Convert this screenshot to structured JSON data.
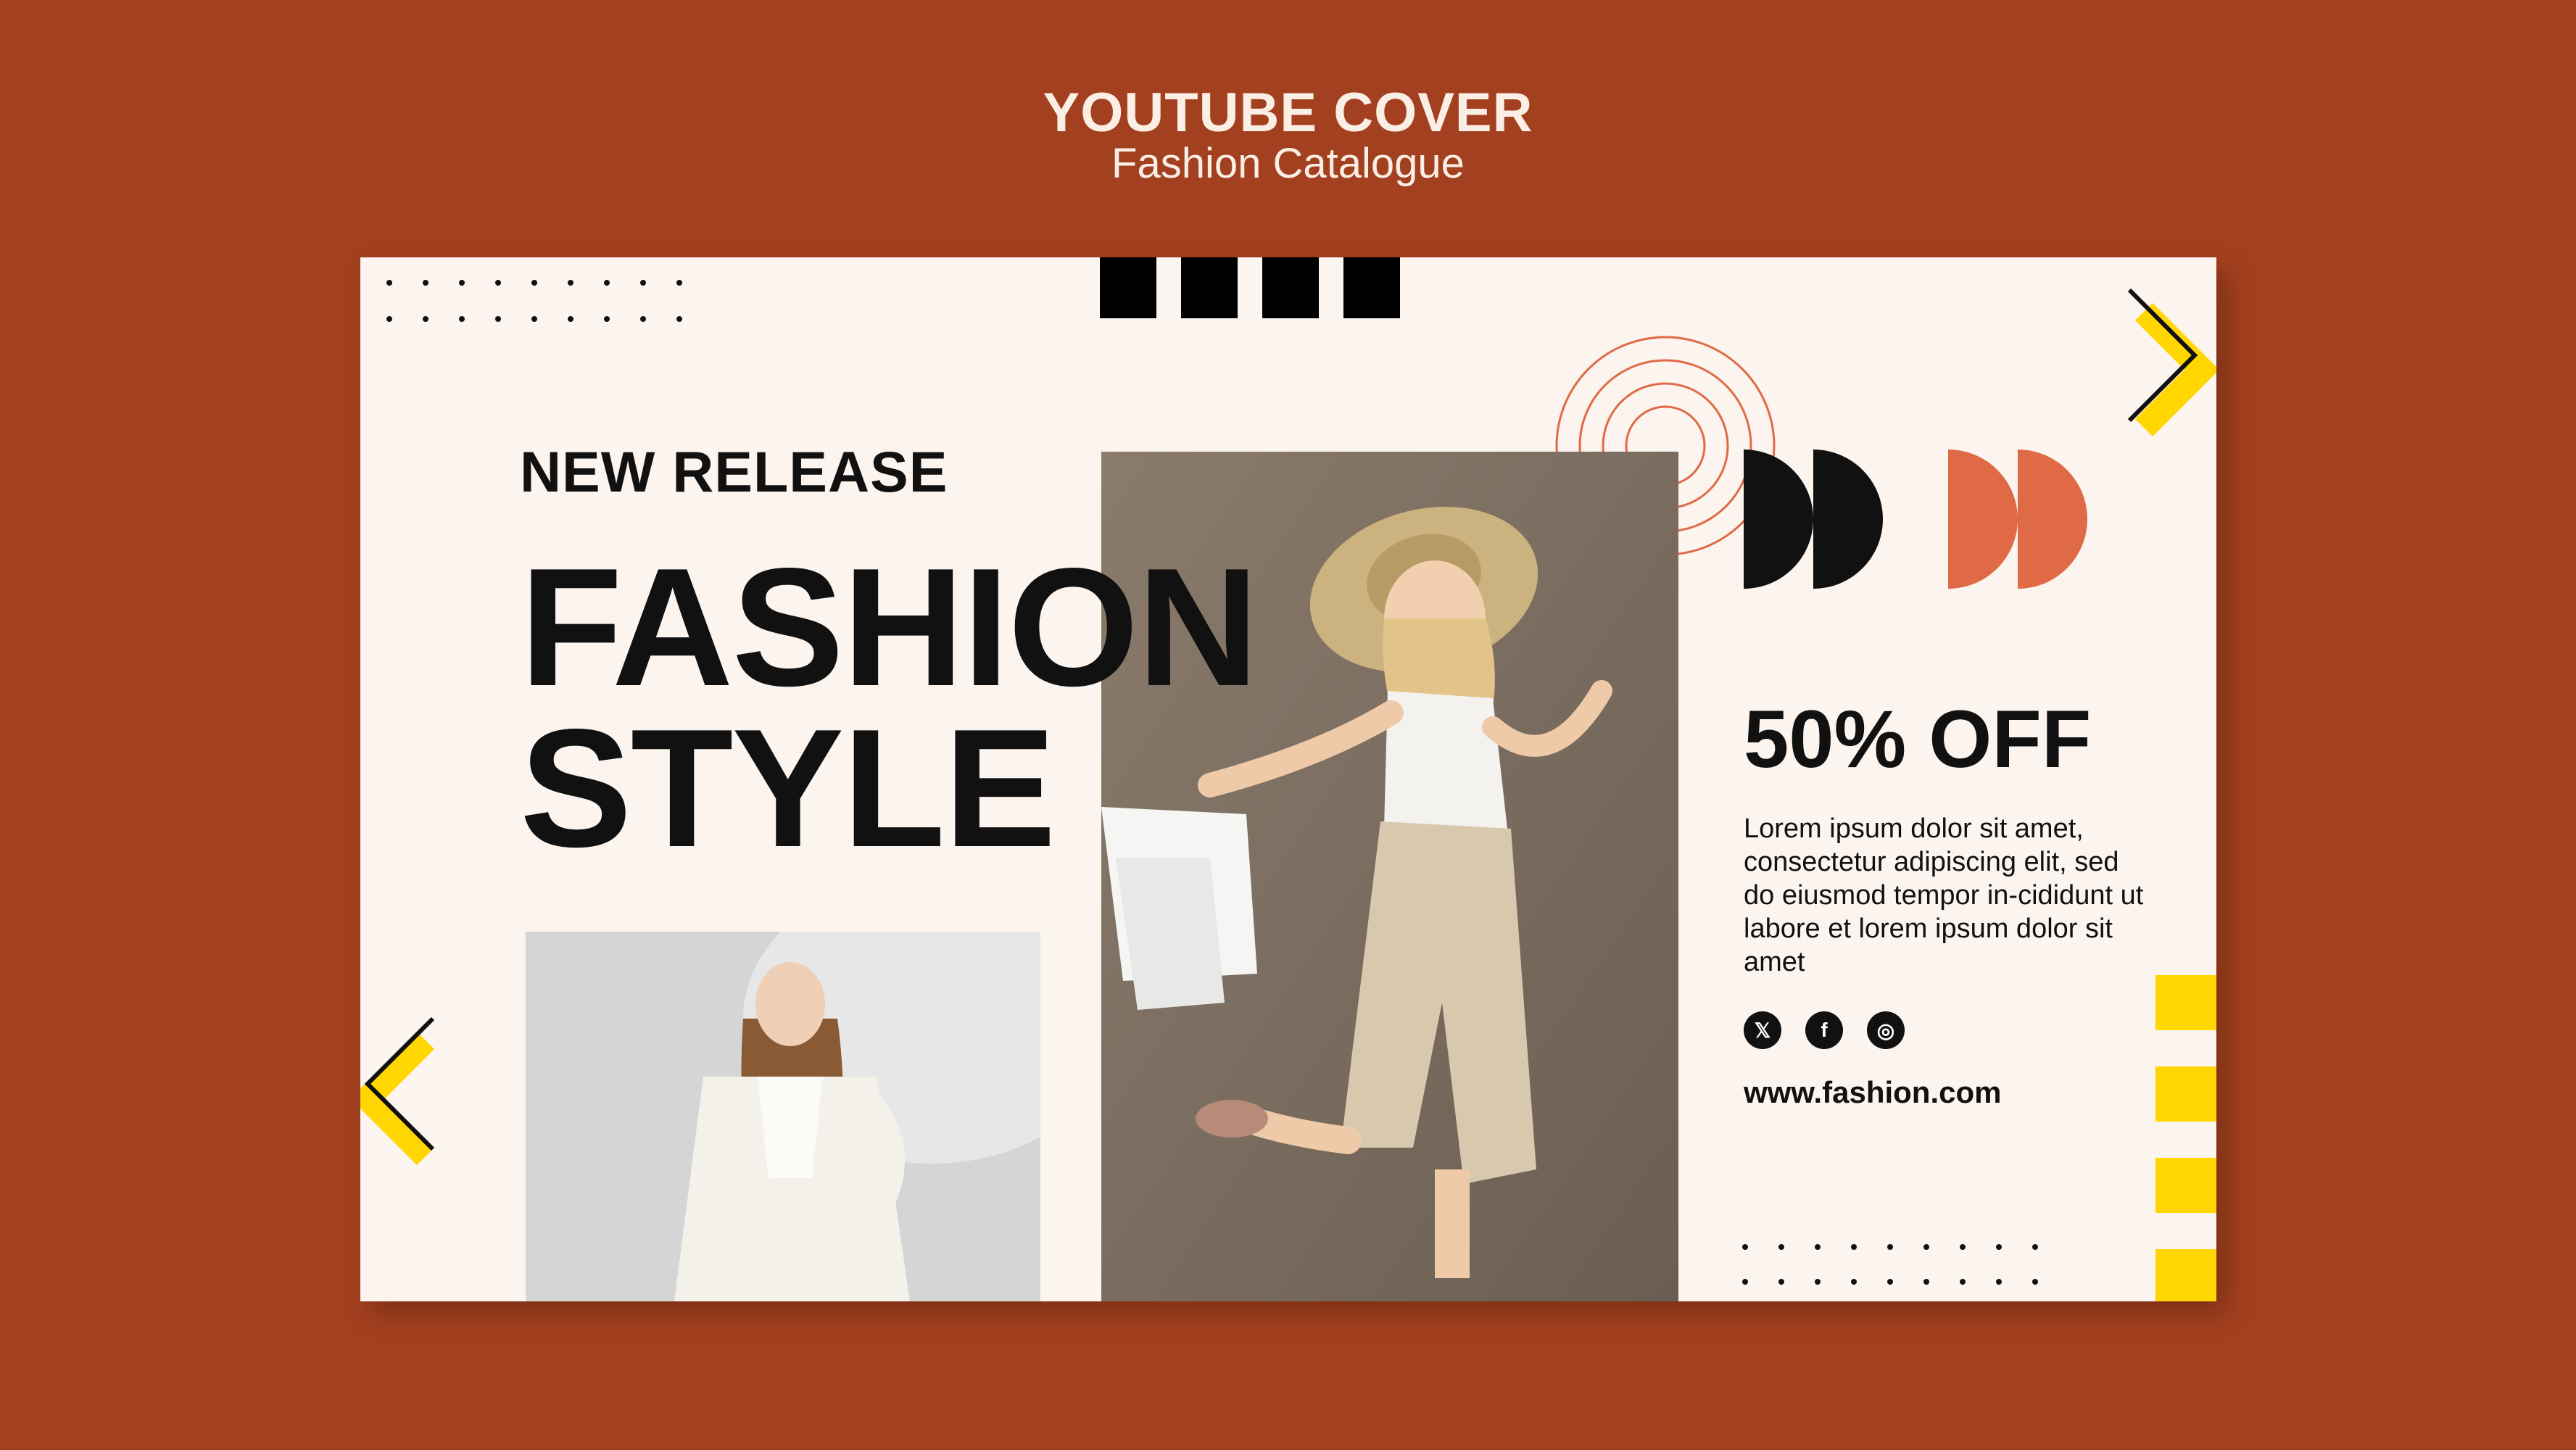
{
  "header": {
    "title": "YOUTUBE COVER",
    "subtitle": "Fashion Catalogue"
  },
  "colors": {
    "background": "#a3401f",
    "card": "#fcf4ee",
    "accent_orange": "#e06a45",
    "accent_yellow": "#ffd600",
    "ink": "#111111"
  },
  "card": {
    "eyebrow": "NEW RELEASE",
    "headline_line1": "FASHION",
    "headline_line2": "STYLE",
    "offer": "50% OFF",
    "description": "Lorem ipsum dolor sit amet, consectetur adipiscing elit, sed do eiusmod tempor in-cididunt ut labore et lorem ipsum dolor sit amet",
    "social": [
      {
        "icon": "x-icon",
        "glyph": "𝕏"
      },
      {
        "icon": "facebook-icon",
        "glyph": "f"
      },
      {
        "icon": "instagram-icon",
        "glyph": "◎"
      }
    ],
    "url": "www.fashion.com"
  },
  "images": {
    "main_photo": "woman-jumping-with-shopping-bags",
    "small_photo": "woman-in-white-suit"
  }
}
